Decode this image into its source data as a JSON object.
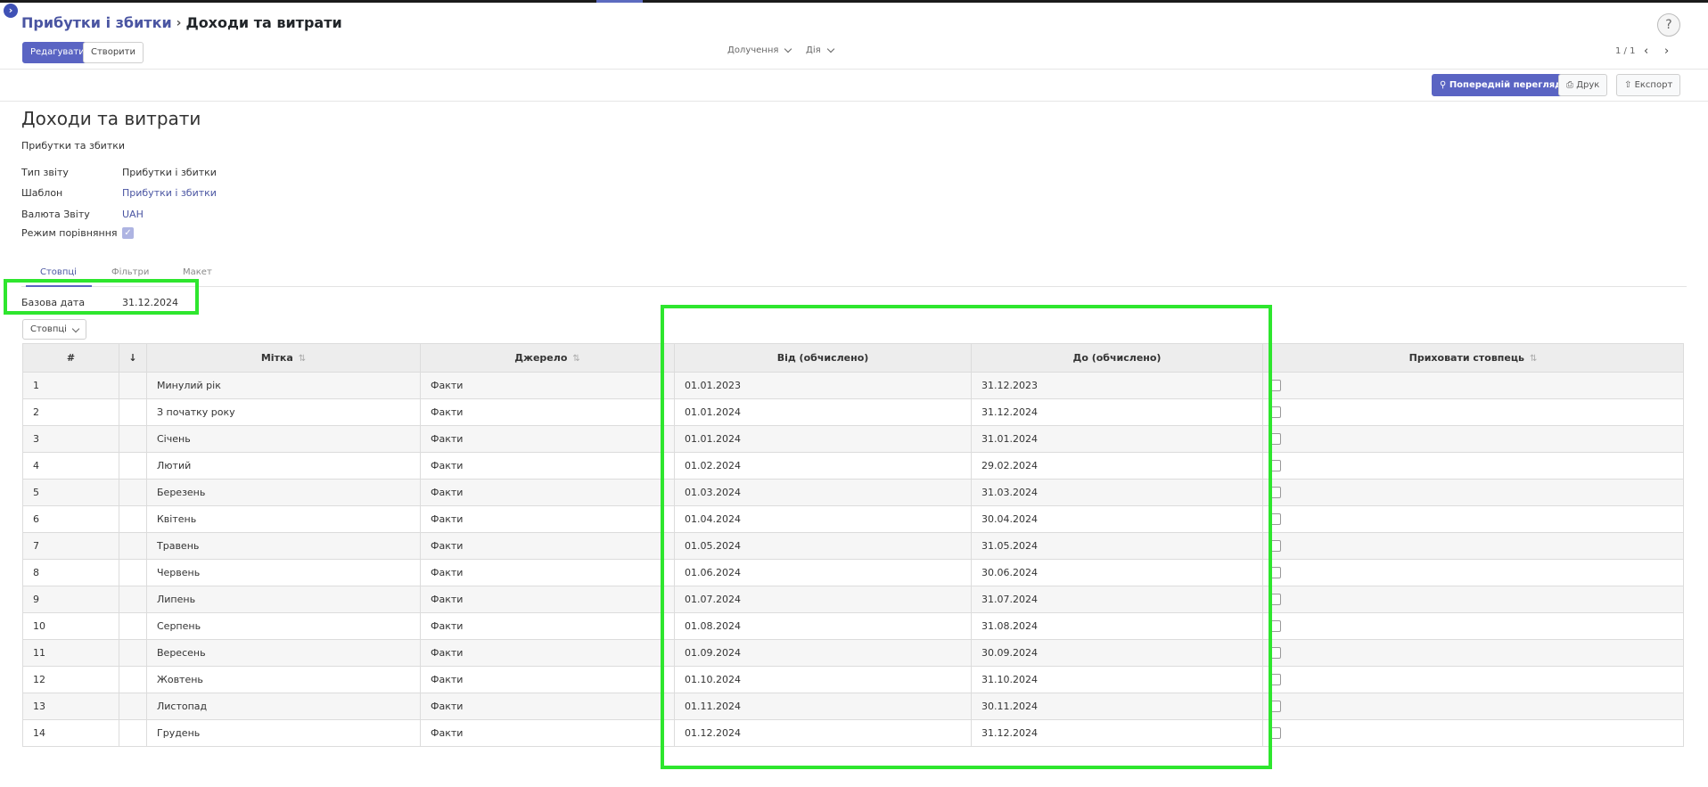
{
  "breadcrumb": {
    "parent": "Прибутки і збитки",
    "separator": "›",
    "current": "Доходи та витрати"
  },
  "control_panel": {
    "edit_label": "Редагувати",
    "create_label": "Створити",
    "attach_label": "Долучення",
    "action_label": "Дія",
    "pager": "1 / 1",
    "help_label": "?"
  },
  "toolbar": {
    "preview_label": "Попередній перегляд",
    "print_label": "Друк",
    "export_label": "Експорт"
  },
  "form": {
    "title": "Доходи та витрати",
    "subtitle": "Прибутки та збитки",
    "fields": {
      "report_type_label": "Тип звіту",
      "report_type_value": "Прибутки і збитки",
      "template_label": "Шаблон",
      "template_value": "Прибутки і збитки",
      "currency_label": "Валюта Звіту",
      "currency_value": "UAH",
      "comparison_label": "Режим порівняння",
      "comparison_checked": true
    },
    "tabs": [
      "Стовпці",
      "Фільтри",
      "Макет"
    ],
    "base_date_label": "Базова дата",
    "base_date_value": "31.12.2024",
    "columns_button": "Стовпці"
  },
  "table": {
    "headers": [
      "#",
      "↓",
      "Мітка",
      "Джерело",
      "Від (обчислено)",
      "До (обчислено)",
      "Приховати стовпець"
    ],
    "rows": [
      {
        "n": "1",
        "label": "Минулий рік",
        "source": "Факти",
        "from": "01.01.2023",
        "to": "31.12.2023"
      },
      {
        "n": "2",
        "label": "З початку року",
        "source": "Факти",
        "from": "01.01.2024",
        "to": "31.12.2024"
      },
      {
        "n": "3",
        "label": "Січень",
        "source": "Факти",
        "from": "01.01.2024",
        "to": "31.01.2024"
      },
      {
        "n": "4",
        "label": "Лютий",
        "source": "Факти",
        "from": "01.02.2024",
        "to": "29.02.2024"
      },
      {
        "n": "5",
        "label": "Березень",
        "source": "Факти",
        "from": "01.03.2024",
        "to": "31.03.2024"
      },
      {
        "n": "6",
        "label": "Квітень",
        "source": "Факти",
        "from": "01.04.2024",
        "to": "30.04.2024"
      },
      {
        "n": "7",
        "label": "Травень",
        "source": "Факти",
        "from": "01.05.2024",
        "to": "31.05.2024"
      },
      {
        "n": "8",
        "label": "Червень",
        "source": "Факти",
        "from": "01.06.2024",
        "to": "30.06.2024"
      },
      {
        "n": "9",
        "label": "Липень",
        "source": "Факти",
        "from": "01.07.2024",
        "to": "31.07.2024"
      },
      {
        "n": "10",
        "label": "Серпень",
        "source": "Факти",
        "from": "01.08.2024",
        "to": "31.08.2024"
      },
      {
        "n": "11",
        "label": "Вересень",
        "source": "Факти",
        "from": "01.09.2024",
        "to": "30.09.2024"
      },
      {
        "n": "12",
        "label": "Жовтень",
        "source": "Факти",
        "from": "01.10.2024",
        "to": "31.10.2024"
      },
      {
        "n": "13",
        "label": "Листопад",
        "source": "Факти",
        "from": "01.11.2024",
        "to": "30.11.2024"
      },
      {
        "n": "14",
        "label": "Грудень",
        "source": "Факти",
        "from": "01.12.2024",
        "to": "31.12.2024"
      }
    ]
  },
  "colors": {
    "accent": "#5a64c3",
    "link": "#4a55a2",
    "highlight": "#2ee62e"
  }
}
